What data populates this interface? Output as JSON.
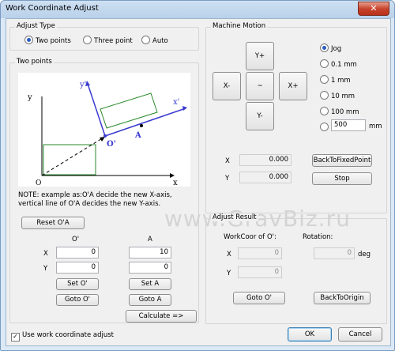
{
  "window": {
    "title": "Work Coordinate Adjust",
    "close_label": "✕"
  },
  "adjust_type": {
    "title": "Adjust Type",
    "options": [
      {
        "label": "Two points",
        "checked": true
      },
      {
        "label": "Three point",
        "checked": false
      },
      {
        "label": "Auto",
        "checked": false
      }
    ]
  },
  "two_points": {
    "title": "Two points",
    "diagram": {
      "y_axis": "y",
      "x_axis": "x",
      "origin": "O",
      "y_prime": "y'",
      "x_prime": "x'",
      "o_prime": "O'",
      "a_point": "A"
    },
    "note": "NOTE: example as:O'A decide the new X-axis, vertical line of O'A decides the new Y-axis.",
    "reset_label": "Reset O'A",
    "col_o": "O'",
    "col_a": "A",
    "row_x": "X",
    "row_y": "Y",
    "o_x": "0",
    "o_y": "0",
    "a_x": "10",
    "a_y": "0",
    "set_o": "Set O'",
    "set_a": "Set A",
    "goto_o": "Goto O'",
    "goto_a": "Goto A",
    "calculate": "Calculate =>"
  },
  "machine_motion": {
    "title": "Machine Motion",
    "y_plus": "Y+",
    "x_minus": "X-",
    "center": "~",
    "x_plus": "X+",
    "y_minus": "Y-",
    "steps": [
      {
        "label": "Jog",
        "checked": true
      },
      {
        "label": "0.1 mm",
        "checked": false
      },
      {
        "label": "1 mm",
        "checked": false
      },
      {
        "label": "10 mm",
        "checked": false
      },
      {
        "label": "100 mm",
        "checked": false
      }
    ],
    "custom_value": "500",
    "custom_unit": "mm",
    "x_label": "X",
    "y_label": "Y",
    "x_value": "0.000",
    "y_value": "0.000",
    "back_fixed": "BackToFixedPoint",
    "stop": "Stop"
  },
  "adjust_result": {
    "title": "Adjust Result",
    "workcoor_label": "WorkCoor of O':",
    "rotation_label": "Rotation:",
    "x_label": "X",
    "y_label": "Y",
    "x_value": "0",
    "y_value": "0",
    "rotation_value": "0",
    "rotation_unit": "deg",
    "goto_o": "Goto O'",
    "back_origin": "BackToOrigin"
  },
  "footer": {
    "use_work_coord": "Use work coordinate adjust",
    "use_checked": true,
    "ok": "OK",
    "cancel": "Cancel"
  },
  "watermark": "www.GravBiz.ru"
}
